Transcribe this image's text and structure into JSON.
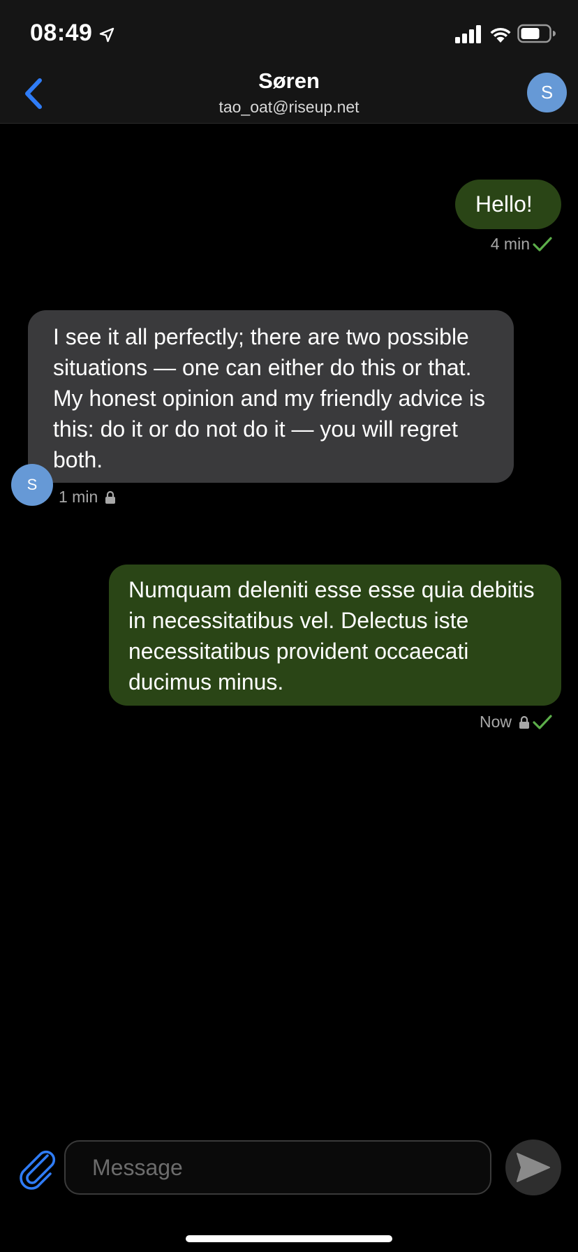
{
  "status_bar": {
    "time": "08:49",
    "icons": [
      "location-arrow-icon",
      "signal-icon",
      "wifi-icon",
      "battery-icon"
    ]
  },
  "header": {
    "back_icon": "chevron-left-icon",
    "contact_name": "Søren",
    "contact_email": "tao_oat@riseup.net",
    "avatar_initial": "S"
  },
  "messages": [
    {
      "direction": "outgoing",
      "text": "Hello!",
      "time": "4 min",
      "encrypted": false,
      "delivered": true
    },
    {
      "direction": "incoming",
      "text": "I see it all perfectly; there are two possible situations — one can either do this or that. My honest opinion and my friendly advice is this: do it or do not do it — you will regret both.",
      "time": "1 min",
      "sender_initial": "S",
      "encrypted": true,
      "delivered": false
    },
    {
      "direction": "outgoing",
      "text": "Numquam deleniti esse esse quia debitis in necessitatibus vel. Delectus iste necessitatibus provident occaecati ducimus minus.",
      "time": "Now",
      "encrypted": true,
      "delivered": true
    }
  ],
  "composer": {
    "placeholder": "Message",
    "value": "",
    "attach_icon": "paperclip-icon",
    "send_icon": "send-icon"
  },
  "colors": {
    "accent": "#2f7cf6",
    "avatar": "#6699d6",
    "outgoing_bubble": "#2a4516",
    "incoming_bubble": "#3a3a3c",
    "checkmark": "#5cae4a",
    "background": "#000000"
  }
}
